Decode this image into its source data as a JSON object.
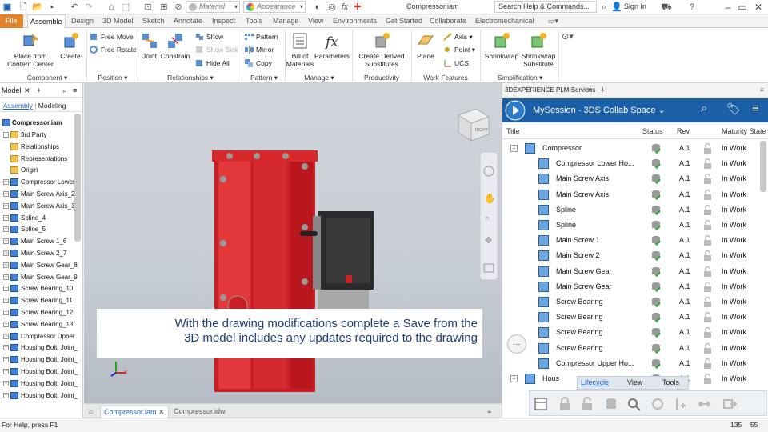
{
  "titlebar": {
    "document_title": "Compressor.iam",
    "material_label": "Material",
    "appearance_label": "Appearance",
    "help_search_placeholder": "Search Help & Commands...",
    "sign_in": "Sign In"
  },
  "ribbon_tabs": [
    "File",
    "Assemble",
    "Design",
    "3D Model",
    "Sketch",
    "Annotate",
    "Inspect",
    "Tools",
    "Manage",
    "View",
    "Environments",
    "Get Started",
    "Collaborate",
    "Electromechanical"
  ],
  "ribbon": {
    "component": {
      "place_line1": "Place from",
      "place_line2": "Content Center",
      "create": "Create",
      "label": "Component"
    },
    "position": {
      "free_move": "Free Move",
      "free_rotate": "Free Rotate",
      "label": "Position"
    },
    "relationships": {
      "joint": "Joint",
      "constrain": "Constrain",
      "show": "Show",
      "show_sick": "Show Sick",
      "hide_all": "Hide All",
      "label": "Relationships"
    },
    "pattern": {
      "pattern": "Pattern",
      "mirror": "Mirror",
      "copy": "Copy",
      "label": "Pattern"
    },
    "manage": {
      "bom_line1": "Bill of",
      "bom_line2": "Materials",
      "parameters": "Parameters",
      "label": "Manage"
    },
    "productivity": {
      "derived_line1": "Create Derived",
      "derived_line2": "Substitutes",
      "label": "Productivity"
    },
    "work_features": {
      "plane": "Plane",
      "axis": "Axis",
      "point": "Point",
      "ucs": "UCS",
      "label": "Work Features"
    },
    "simplification": {
      "shrinkwrap": "Shrinkwrap",
      "sw_sub_line1": "Shrinkwrap",
      "sw_sub_line2": "Substitute",
      "label": "Simplification"
    }
  },
  "model_browser": {
    "title": "Model",
    "tabs": {
      "assembly": "Assembly",
      "modeling": "Modeling"
    },
    "root": "Compressor.iam",
    "items": [
      "3rd Party",
      "Relationships",
      "Representations",
      "Origin",
      "Compressor Lower",
      "Main Screw Axis_2",
      "Main Screw Axis_3",
      "Spline_4",
      "Spline_5",
      "Main Screw 1_6",
      "Main Screw 2_7",
      "Main Screw Gear_8",
      "Main Screw Gear_9",
      "Screw Bearing_10",
      "Screw Bearing_11",
      "Screw Bearing_12",
      "Screw Bearing_13",
      "Compressor Upper",
      "Housing Bolt: Joint_",
      "Housing Bolt: Joint_",
      "Housing Bolt: Joint_",
      "Housing Bolt: Joint_",
      "Housing Bolt: Joint_"
    ]
  },
  "viewport": {
    "caption_line1": "With the drawing modifications complete a Save from the",
    "caption_line2": "3D model includes any updates required to the drawing",
    "viewcube_label": "RIGHT"
  },
  "document_tabs": [
    "Compressor.iam",
    "Compressor.idw"
  ],
  "status_bar": {
    "help_text": "For Help, press F1",
    "num1": "135",
    "num2": "55"
  },
  "plm": {
    "tab_title": "3DEXPERIENCE PLM Services",
    "session_title": "MySession - 3DS Collab Space",
    "columns": {
      "title": "Title",
      "status": "Status",
      "rev": "Rev",
      "maturity": "Maturity State"
    },
    "rows": [
      {
        "title": "Compressor",
        "rev": "A.1",
        "maturity": "In Work"
      },
      {
        "title": "Compressor Lower Ho...",
        "rev": "A.1",
        "maturity": "In Work"
      },
      {
        "title": "Main Screw Axis",
        "rev": "A.1",
        "maturity": "In Work"
      },
      {
        "title": "Main Screw Axis",
        "rev": "A.1",
        "maturity": "In Work"
      },
      {
        "title": "Spline",
        "rev": "A.1",
        "maturity": "In Work"
      },
      {
        "title": "Spline",
        "rev": "A.1",
        "maturity": "In Work"
      },
      {
        "title": "Main Screw 1",
        "rev": "A.1",
        "maturity": "In Work"
      },
      {
        "title": "Main Screw 2",
        "rev": "A.1",
        "maturity": "In Work"
      },
      {
        "title": "Main Screw Gear",
        "rev": "A.1",
        "maturity": "In Work"
      },
      {
        "title": "Main Screw Gear",
        "rev": "A.1",
        "maturity": "In Work"
      },
      {
        "title": "Screw Bearing",
        "rev": "A.1",
        "maturity": "In Work"
      },
      {
        "title": "Screw Bearing",
        "rev": "A.1",
        "maturity": "In Work"
      },
      {
        "title": "Screw Bearing",
        "rev": "A.1",
        "maturity": "In Work"
      },
      {
        "title": "Screw Bearing",
        "rev": "A.1",
        "maturity": "In Work"
      },
      {
        "title": "Compressor Upper Ho...",
        "rev": "A.1",
        "maturity": "In Work"
      },
      {
        "title": "Hous",
        "rev": "A.1",
        "maturity": "In Work"
      }
    ],
    "tooltip_tabs": [
      "Lifecycle",
      "View",
      "Tools"
    ]
  },
  "colors": {
    "accent": "#1b5fa8",
    "file_tab": "#e0832c",
    "caption_text": "#1d3c7c",
    "housing_red": "#d8262b"
  }
}
